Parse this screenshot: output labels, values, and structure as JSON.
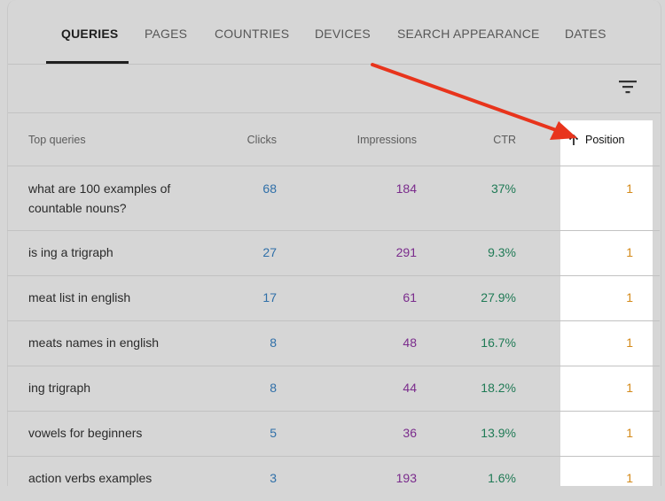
{
  "tabs": [
    {
      "label": "QUERIES",
      "active": true
    },
    {
      "label": "PAGES",
      "active": false
    },
    {
      "label": "COUNTRIES",
      "active": false
    },
    {
      "label": "DEVICES",
      "active": false
    },
    {
      "label": "SEARCH APPEARANCE",
      "active": false
    },
    {
      "label": "DATES",
      "active": false
    }
  ],
  "filter": {
    "icon": "filter-icon"
  },
  "table": {
    "headers": {
      "query": "Top queries",
      "clicks": "Clicks",
      "impressions": "Impressions",
      "ctr": "CTR",
      "position": "Position",
      "sort_icon": "arrow-up-icon"
    },
    "rows": [
      {
        "query": "what are 100 examples of countable nouns?",
        "clicks": "68",
        "impressions": "184",
        "ctr": "37%",
        "position": "1"
      },
      {
        "query": "is ing a trigraph",
        "clicks": "27",
        "impressions": "291",
        "ctr": "9.3%",
        "position": "1"
      },
      {
        "query": "meat list in english",
        "clicks": "17",
        "impressions": "61",
        "ctr": "27.9%",
        "position": "1"
      },
      {
        "query": "meats names in english",
        "clicks": "8",
        "impressions": "48",
        "ctr": "16.7%",
        "position": "1"
      },
      {
        "query": "ing trigraph",
        "clicks": "8",
        "impressions": "44",
        "ctr": "18.2%",
        "position": "1"
      },
      {
        "query": "vowels for beginners",
        "clicks": "5",
        "impressions": "36",
        "ctr": "13.9%",
        "position": "1"
      },
      {
        "query": "action verbs examples",
        "clicks": "3",
        "impressions": "193",
        "ctr": "1.6%",
        "position": "1"
      }
    ]
  },
  "colors": {
    "clicks": "#2f6fa8",
    "impressions": "#7a2b8c",
    "ctr": "#1f7a55",
    "position": "#d48a1a",
    "annotation_arrow": "#e8341c"
  }
}
